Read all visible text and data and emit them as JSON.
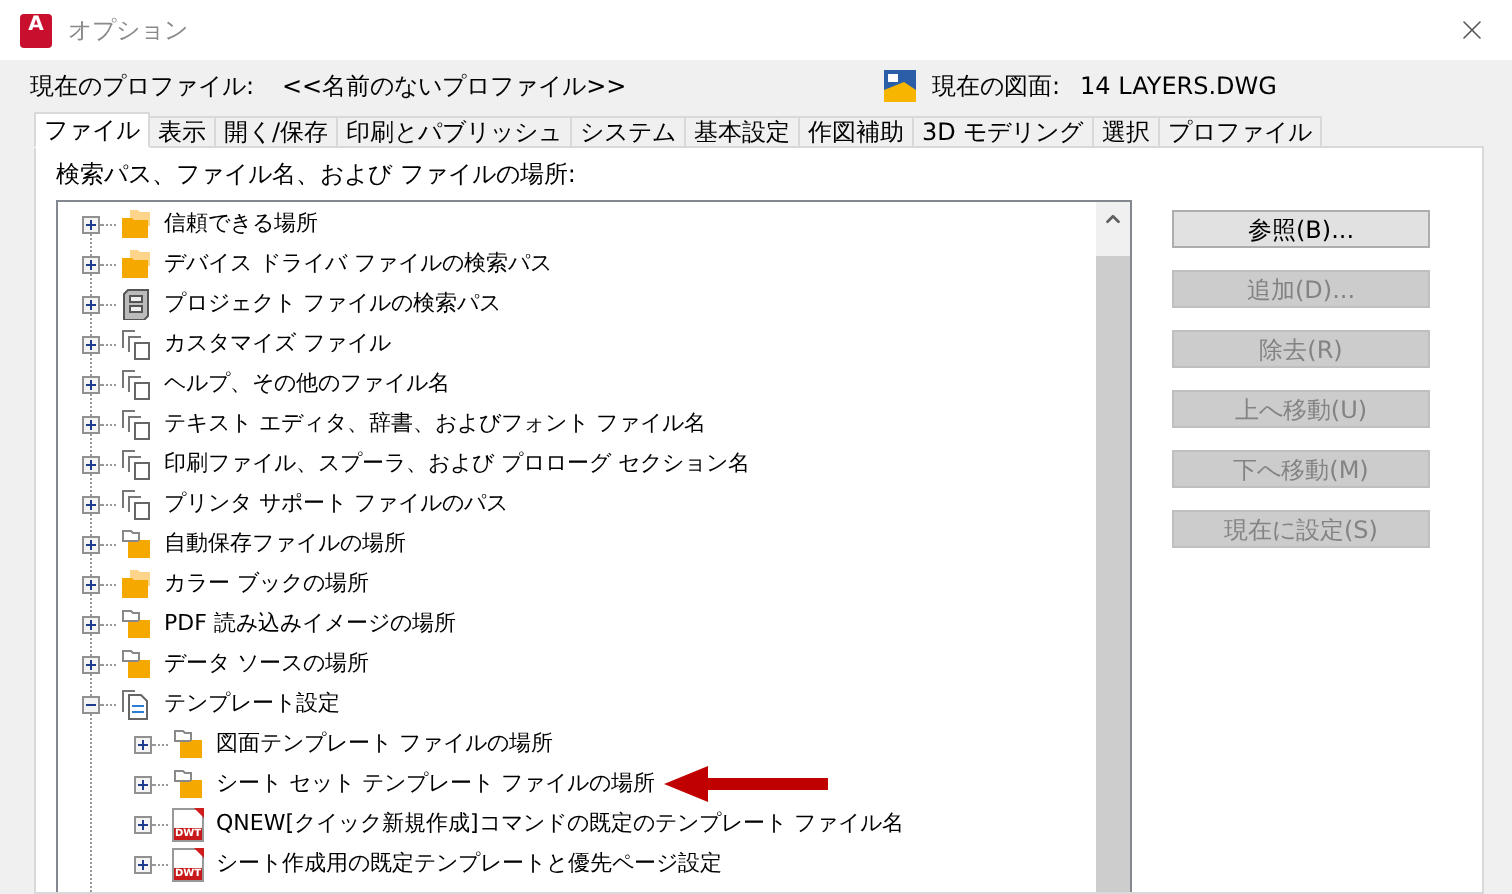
{
  "window": {
    "title": "オプション",
    "logo_text": "A"
  },
  "profile": {
    "label": "現在のプロファイル:",
    "value": "<<名前のないプロファイル>>",
    "drawing_label": "現在の図面:",
    "drawing_value": "14 LAYERS.DWG"
  },
  "tabs": [
    {
      "label": "ファイル",
      "selected": true
    },
    {
      "label": "表示",
      "selected": false
    },
    {
      "label": "開く/保存",
      "selected": false
    },
    {
      "label": "印刷とパブリッシュ",
      "selected": false
    },
    {
      "label": "システム",
      "selected": false
    },
    {
      "label": "基本設定",
      "selected": false
    },
    {
      "label": "作図補助",
      "selected": false
    },
    {
      "label": "3D モデリング",
      "selected": false
    },
    {
      "label": "選択",
      "selected": false
    },
    {
      "label": "プロファイル",
      "selected": false
    }
  ],
  "tree_label": "検索パス、ファイル名、および ファイルの場所:",
  "tree": [
    {
      "label": "信頼できる場所",
      "kind": "stacked",
      "expanded": false
    },
    {
      "label": "デバイス ドライバ ファイルの検索パス",
      "kind": "stacked",
      "expanded": false
    },
    {
      "label": "プロジェクト ファイルの検索パス",
      "kind": "cabinet",
      "expanded": false
    },
    {
      "label": "カスタマイズ ファイル",
      "kind": "files",
      "expanded": false
    },
    {
      "label": "ヘルプ、その他のファイル名",
      "kind": "files",
      "expanded": false
    },
    {
      "label": "テキスト エディタ、辞書、およびフォント ファイル名",
      "kind": "files",
      "expanded": false
    },
    {
      "label": "印刷ファイル、スプーラ、および プロローグ セクション名",
      "kind": "files",
      "expanded": false
    },
    {
      "label": "プリンタ サポート ファイルのパス",
      "kind": "files",
      "expanded": false
    },
    {
      "label": "自動保存ファイルの場所",
      "kind": "folder",
      "expanded": false
    },
    {
      "label": "カラー ブックの場所",
      "kind": "stacked",
      "expanded": false
    },
    {
      "label": "PDF 読み込みイメージの場所",
      "kind": "folder",
      "expanded": false
    },
    {
      "label": "データ ソースの場所",
      "kind": "folder",
      "expanded": false
    },
    {
      "label": "テンプレート設定",
      "kind": "document",
      "expanded": true,
      "children": [
        {
          "label": "図面テンプレート ファイルの場所",
          "kind": "folder",
          "expanded": false
        },
        {
          "label": "シート セット テンプレート ファイルの場所",
          "kind": "folder",
          "expanded": false
        },
        {
          "label": "QNEW[クイック新規作成]コマンドの既定のテンプレート ファイル名",
          "kind": "template",
          "icon_text": "DWT",
          "expanded": false
        },
        {
          "label": "シート作成用の既定テンプレートと優先ページ設定",
          "kind": "template",
          "icon_text": "DWT",
          "expanded": false
        }
      ]
    }
  ],
  "buttons": [
    {
      "label": "参照(B)...",
      "disabled": false
    },
    {
      "label": "追加(D)...",
      "disabled": true
    },
    {
      "label": "除去(R)",
      "disabled": true
    },
    {
      "label": "上へ移動(U)",
      "disabled": true
    },
    {
      "label": "下へ移動(M)",
      "disabled": true
    },
    {
      "label": "現在に設定(S)",
      "disabled": true
    }
  ]
}
